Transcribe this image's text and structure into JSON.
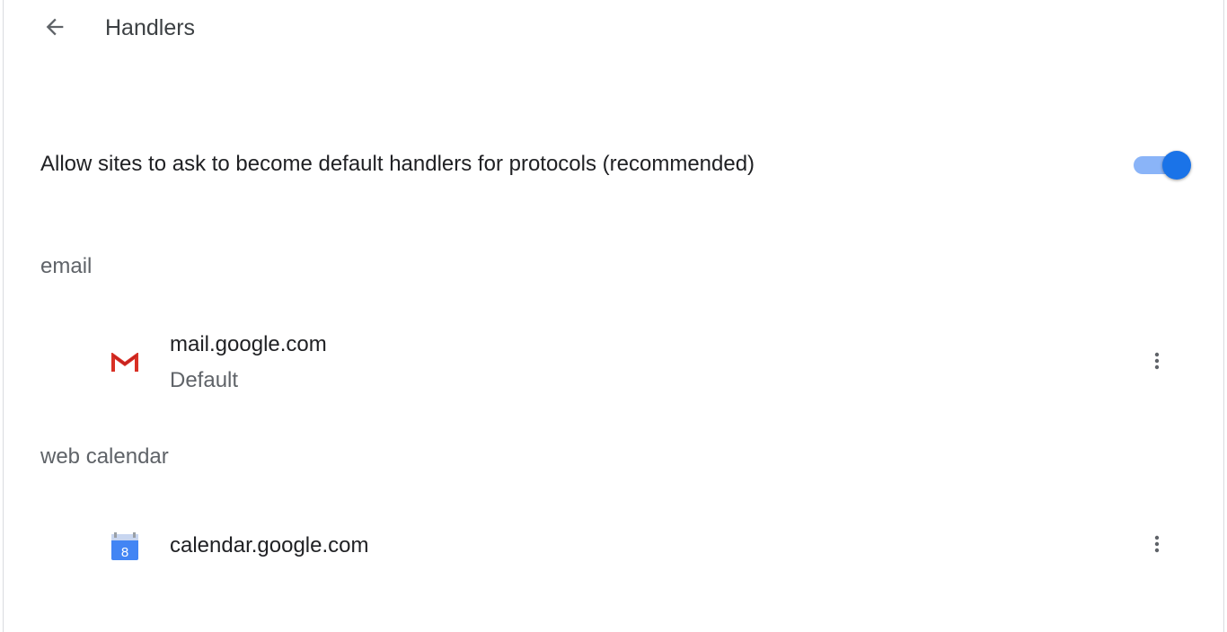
{
  "header": {
    "back_icon": "arrow-back-icon",
    "title": "Handlers"
  },
  "setting": {
    "label": "Allow sites to ask to become default handlers for protocols (recommended)",
    "enabled": true,
    "accent_color": "#1a73e8"
  },
  "sections": [
    {
      "heading": "email",
      "handlers": [
        {
          "icon": "gmail-icon",
          "site": "mail.google.com",
          "status": "Default",
          "menu_icon": "more-vert-icon"
        }
      ]
    },
    {
      "heading": "web calendar",
      "handlers": [
        {
          "icon": "google-calendar-icon",
          "site": "calendar.google.com",
          "calendar_day": "8",
          "menu_icon": "more-vert-icon"
        }
      ]
    }
  ]
}
